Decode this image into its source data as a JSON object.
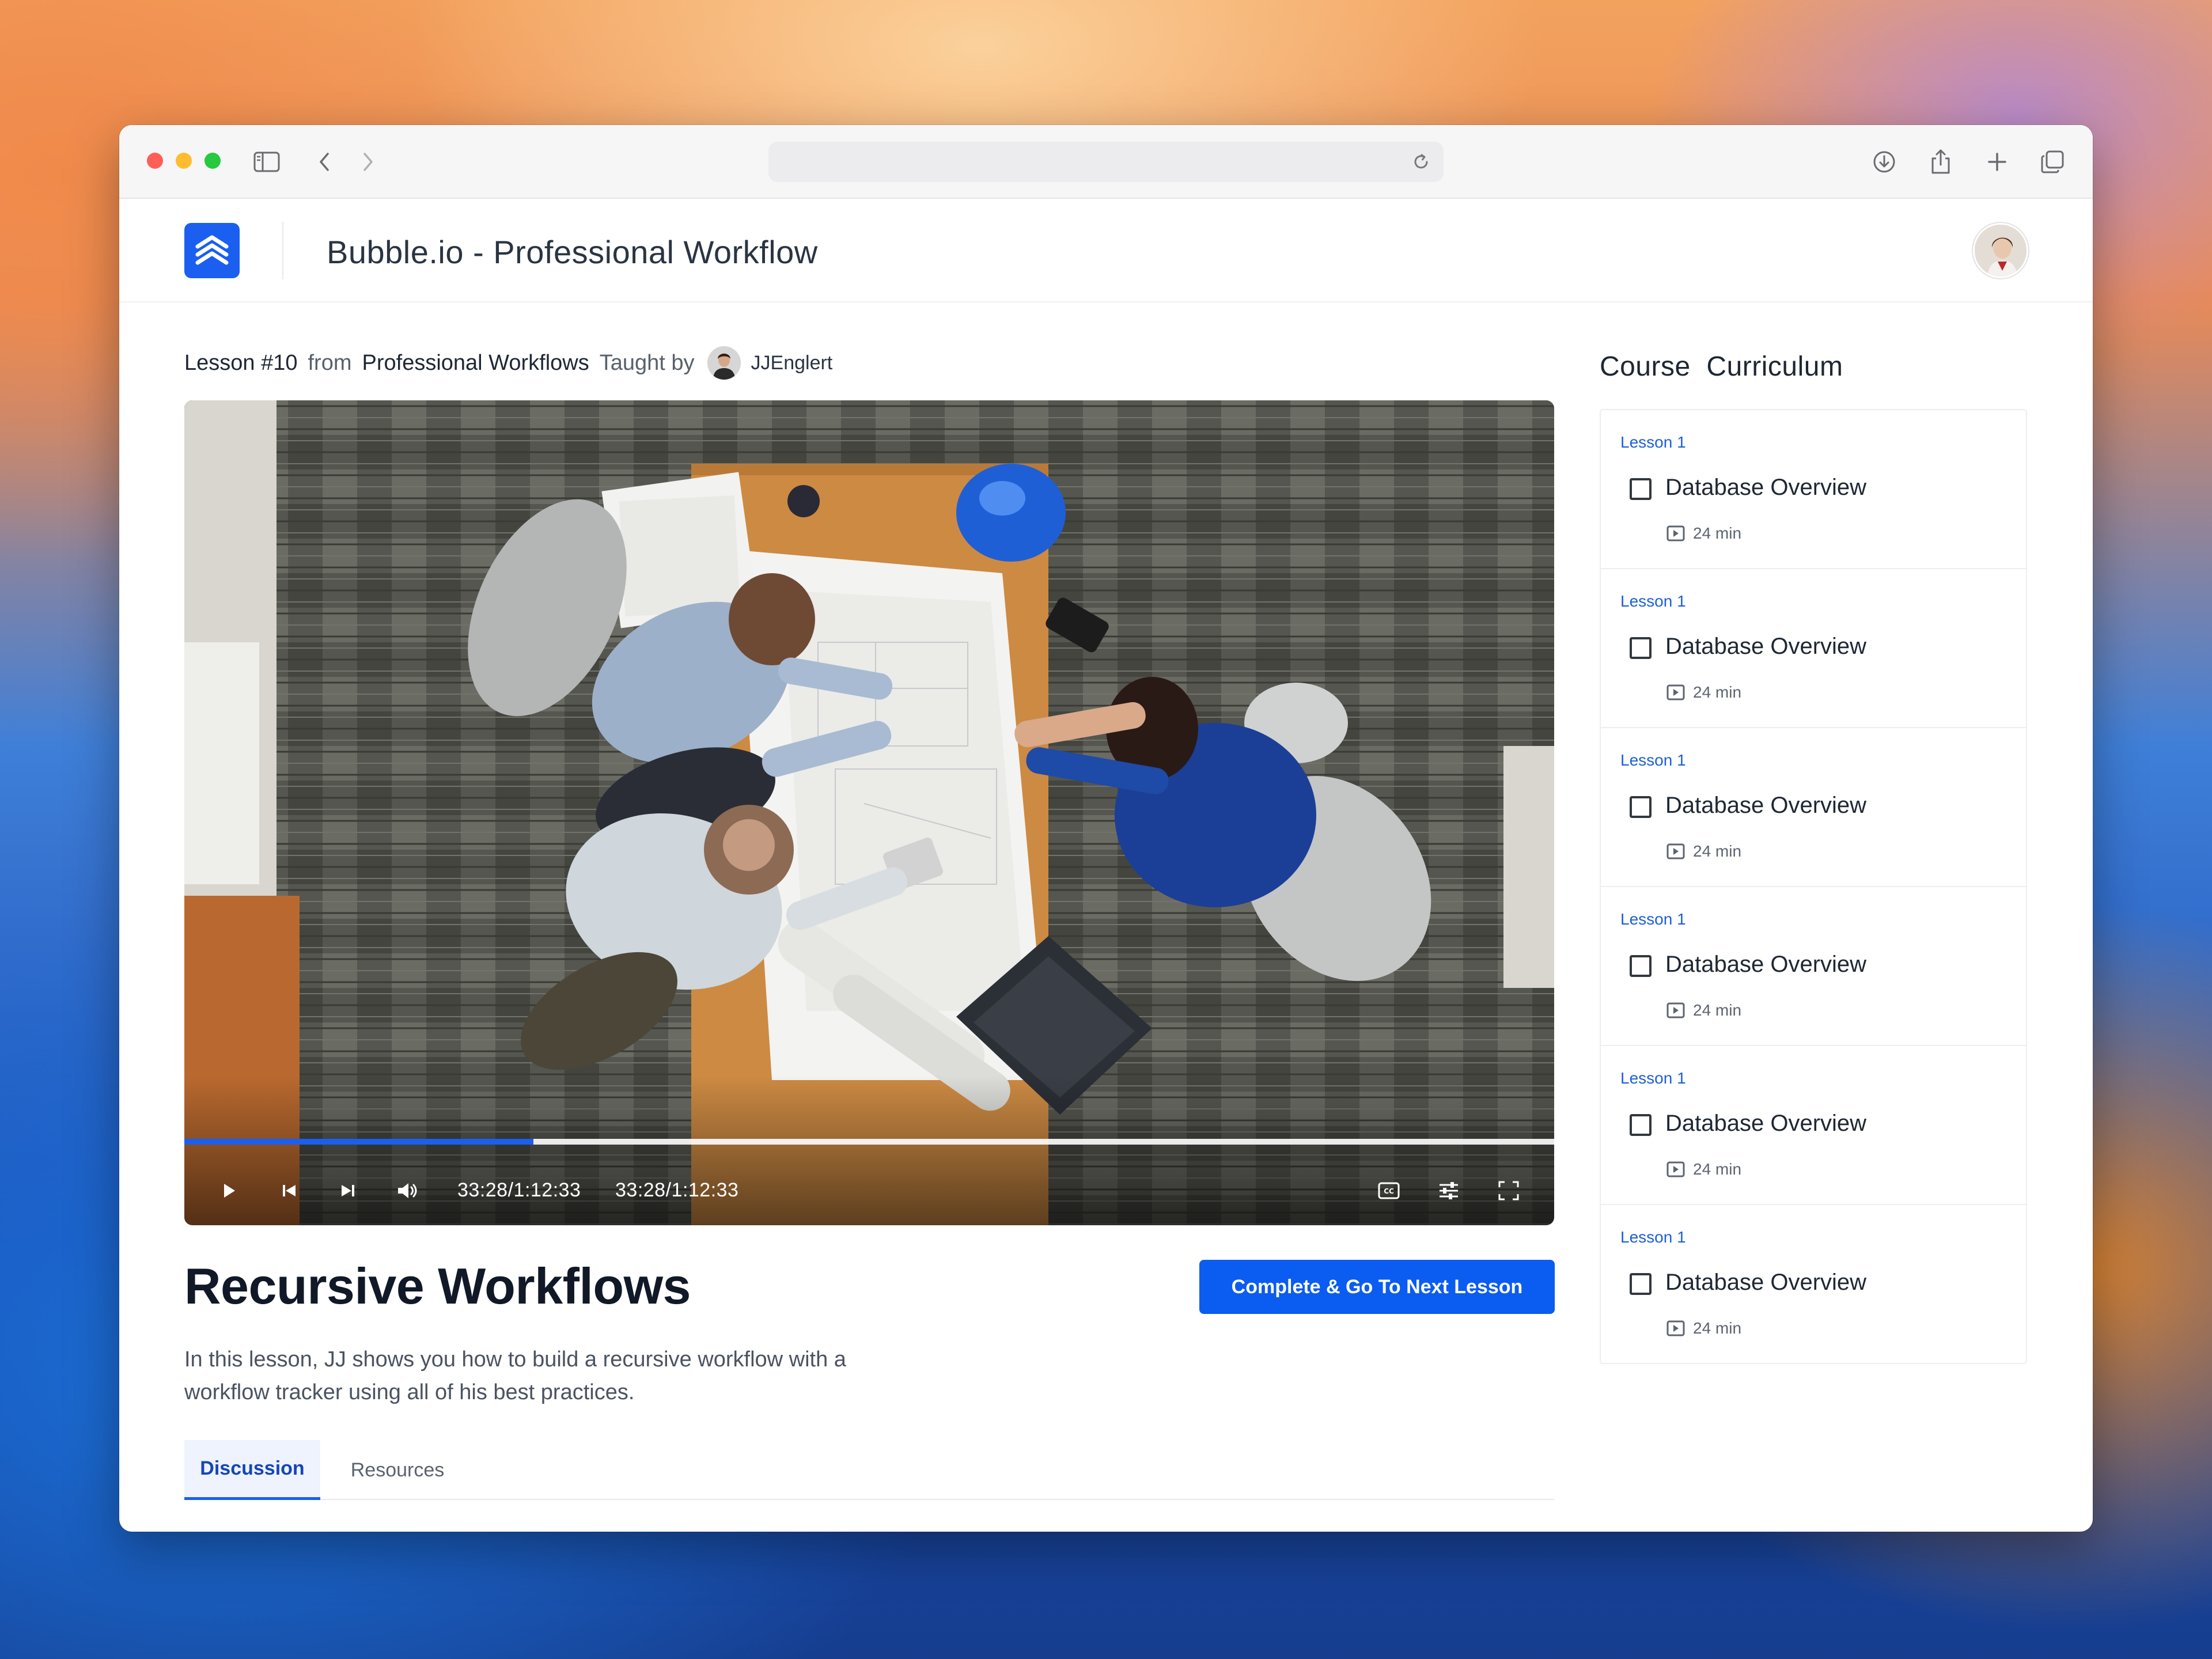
{
  "app": {
    "title": "Bubble.io - Professional Workflow"
  },
  "lesson_meta": {
    "lesson_number": "Lesson #10",
    "from_label": "from",
    "course_name": "Professional Workflows",
    "taught_by_label": "Taught by",
    "teacher_name": "JJEnglert"
  },
  "video": {
    "progress_fraction": 0.255,
    "time_display_1": "33:28/1:12:33",
    "time_display_2": "33:28/1:12:33"
  },
  "lesson": {
    "title": "Recursive Workflows",
    "cta_label": "Complete & Go To Next Lesson",
    "description": "In this lesson, JJ shows you how to build a recursive workflow with a workflow tracker using all of his best practices."
  },
  "tabs": [
    {
      "label": "Discussion",
      "active": true
    },
    {
      "label": "Resources",
      "active": false
    }
  ],
  "curriculum": {
    "title": "Course  Curriculum",
    "items": [
      {
        "lesson": "Lesson 1",
        "name": "Database Overview",
        "duration": "24 min"
      },
      {
        "lesson": "Lesson 1",
        "name": "Database Overview",
        "duration": "24 min"
      },
      {
        "lesson": "Lesson 1",
        "name": "Database Overview",
        "duration": "24 min"
      },
      {
        "lesson": "Lesson 1",
        "name": "Database Overview",
        "duration": "24 min"
      },
      {
        "lesson": "Lesson 1",
        "name": "Database Overview",
        "duration": "24 min"
      },
      {
        "lesson": "Lesson 1",
        "name": "Database Overview",
        "duration": "24 min"
      }
    ]
  },
  "colors": {
    "accent": "#1a5ff0",
    "cta": "#0b5cf0",
    "lesson_link": "#1d5fd6"
  }
}
